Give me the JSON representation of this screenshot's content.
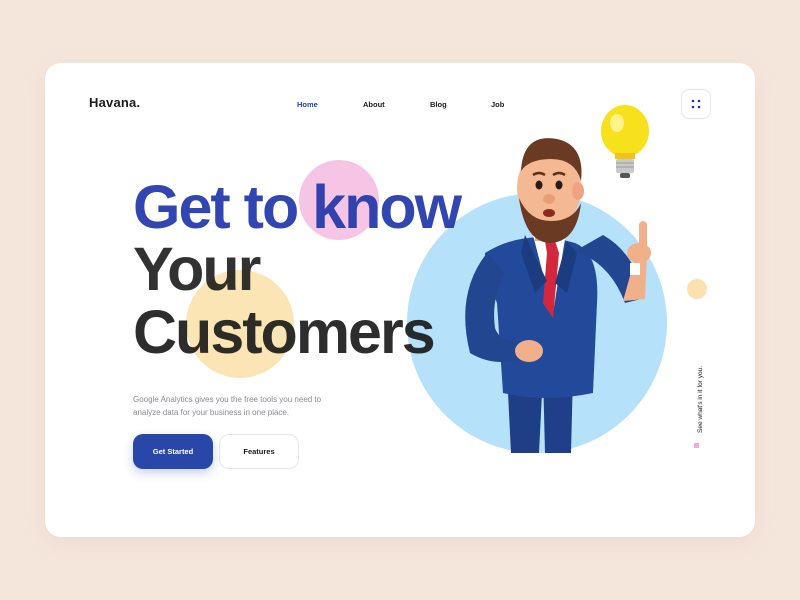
{
  "header": {
    "logo": "Havana.",
    "nav": [
      {
        "label": "Home",
        "active": true
      },
      {
        "label": "About",
        "active": false
      },
      {
        "label": "Blog",
        "active": false
      },
      {
        "label": "Job",
        "active": false
      }
    ],
    "menu_icon": "grid-dots-icon"
  },
  "hero": {
    "headline_line1": "Get to know",
    "headline_line2": "Your",
    "headline_line3": "Customers",
    "description": "Google Analytics gives you the free tools you need to analyze data for your business in one place.",
    "primary_button": "Get Started",
    "secondary_button": "Features"
  },
  "side": {
    "text": "See what's in it for you."
  },
  "colors": {
    "background": "#f5e6dc",
    "card": "#ffffff",
    "accent_blue": "#2847a8",
    "headline_blue": "#1f36aa",
    "pink_blob": "#f6c5e6",
    "yellow_blob": "#fbe5b4",
    "blue_circle": "#b5e1fb"
  },
  "illustration": {
    "name": "businessman-with-lightbulb-illustration"
  }
}
